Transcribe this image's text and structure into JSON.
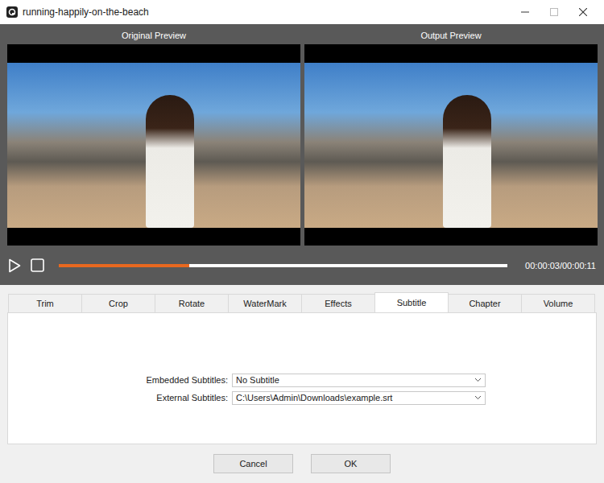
{
  "window": {
    "title": "running-happily-on-the-beach"
  },
  "previews": [
    {
      "label": "Original Preview"
    },
    {
      "label": "Output Preview"
    }
  ],
  "player": {
    "level": 0.29,
    "time": "00:00:03/00:00:11"
  },
  "tabs": [
    {
      "label": "Trim",
      "selected": false
    },
    {
      "label": "Crop",
      "selected": false
    },
    {
      "label": "Rotate",
      "selected": false
    },
    {
      "label": "WaterMark",
      "selected": false
    },
    {
      "label": "Effects",
      "selected": false
    },
    {
      "label": "Subtitle",
      "selected": true
    },
    {
      "label": "Chapter",
      "selected": false
    },
    {
      "label": "Volume",
      "selected": false
    }
  ],
  "subtitle_fields": [
    {
      "label": "Embedded Subtitles:",
      "value": "No Subtitle"
    },
    {
      "label": "External Subtitles:",
      "value": "C:\\Users\\Admin\\Downloads\\example.srt"
    }
  ],
  "buttons": [
    "Cancel",
    "OK"
  ]
}
